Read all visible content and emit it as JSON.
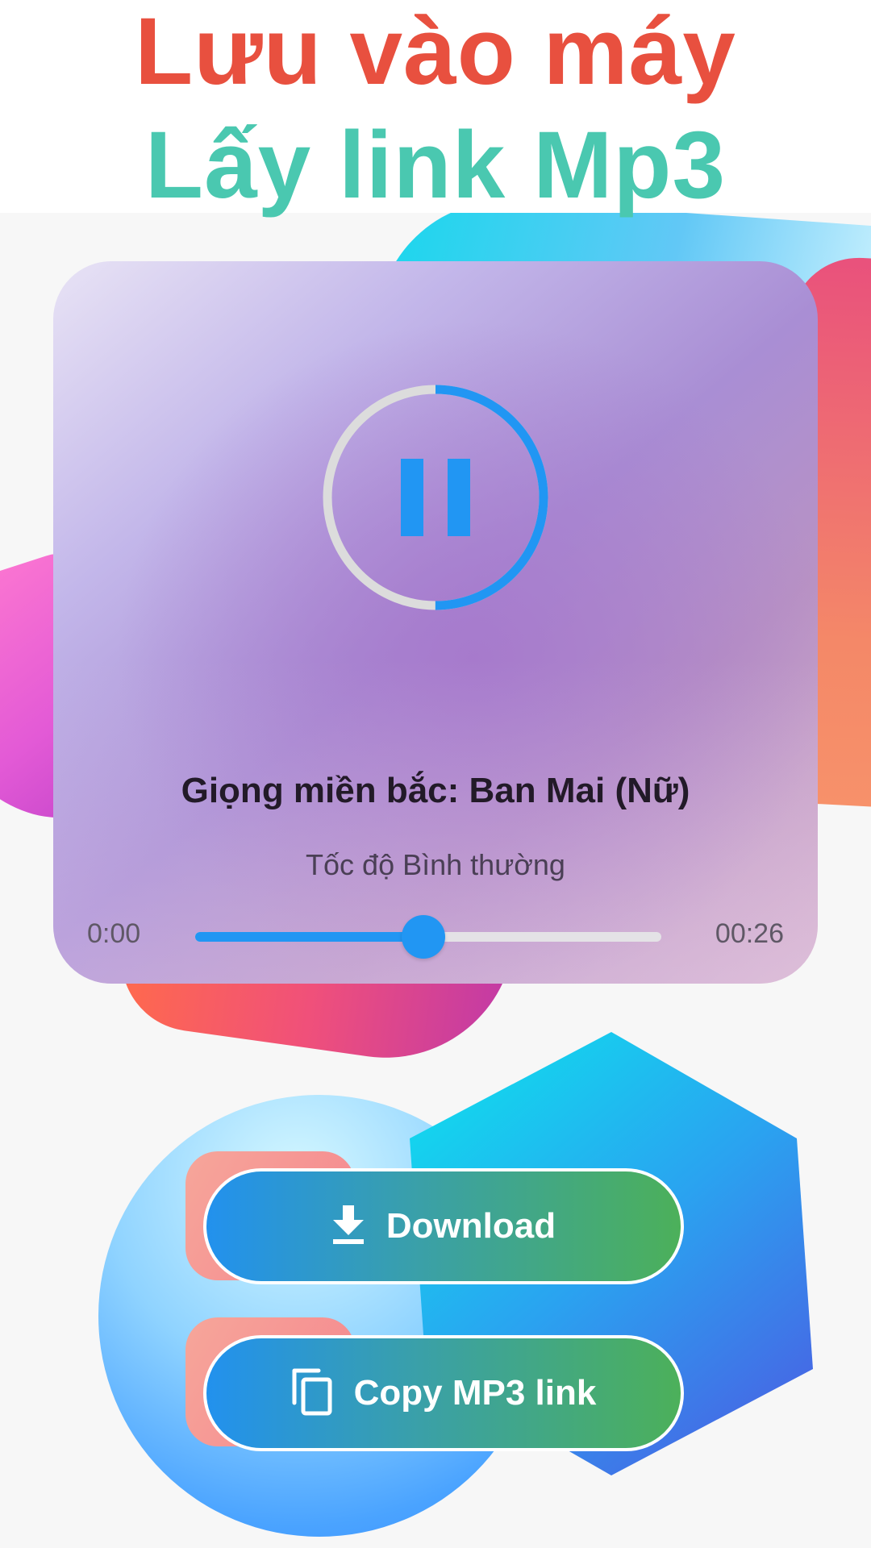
{
  "header": {
    "line1": "Lưu vào máy",
    "line2": "Lấy link Mp3",
    "line1_color": "#e8503f",
    "line2_color": "#4ac8b0"
  },
  "player": {
    "play_state_icon": "pause-icon",
    "ring_progress": 0.5,
    "voice": "Giọng miền bắc: Ban Mai (Nữ)",
    "speed": "Tốc độ Bình thường",
    "time_current": "0:00",
    "time_total": "00:26",
    "slider_progress": 0.49,
    "accent_color": "#2196f3"
  },
  "actions": {
    "download_label": "Download",
    "download_icon": "download-icon",
    "copy_label": "Copy MP3 link",
    "copy_icon": "copy-icon"
  }
}
